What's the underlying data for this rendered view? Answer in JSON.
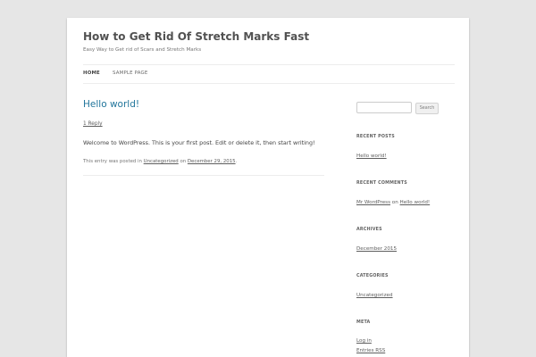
{
  "site": {
    "title": "How to Get Rid Of Stretch Marks Fast",
    "description": "Easy Way to Get rid of Scars and Stretch Marks"
  },
  "nav": {
    "items": [
      {
        "label": "HOME"
      },
      {
        "label": "SAMPLE PAGE"
      }
    ]
  },
  "post": {
    "title": "Hello world!",
    "reply_link": "1 Reply",
    "content": "Welcome to WordPress. This is your first post. Edit or delete it, then start writing!",
    "meta_prefix": "This entry was posted in",
    "category": "Uncategorized",
    "meta_on": "on",
    "date": "December 29, 2015",
    "meta_end": "."
  },
  "search": {
    "placeholder": "",
    "button_label": "Search"
  },
  "sidebar": {
    "recent_posts": {
      "title": "RECENT POSTS",
      "items": [
        "Hello world!"
      ]
    },
    "recent_comments": {
      "title": "RECENT COMMENTS",
      "author": "Mr WordPress",
      "on": "on",
      "post": "Hello world!"
    },
    "archives": {
      "title": "ARCHIVES",
      "items": [
        "December 2015"
      ]
    },
    "categories": {
      "title": "CATEGORIES",
      "items": [
        "Uncategorized"
      ]
    },
    "meta": {
      "title": "META",
      "items": [
        "Log in",
        "Entries RSS"
      ]
    }
  },
  "colors": {
    "background": "#e6e6e6",
    "page": "#ffffff",
    "link_accent": "#21759b",
    "text": "#444444"
  }
}
